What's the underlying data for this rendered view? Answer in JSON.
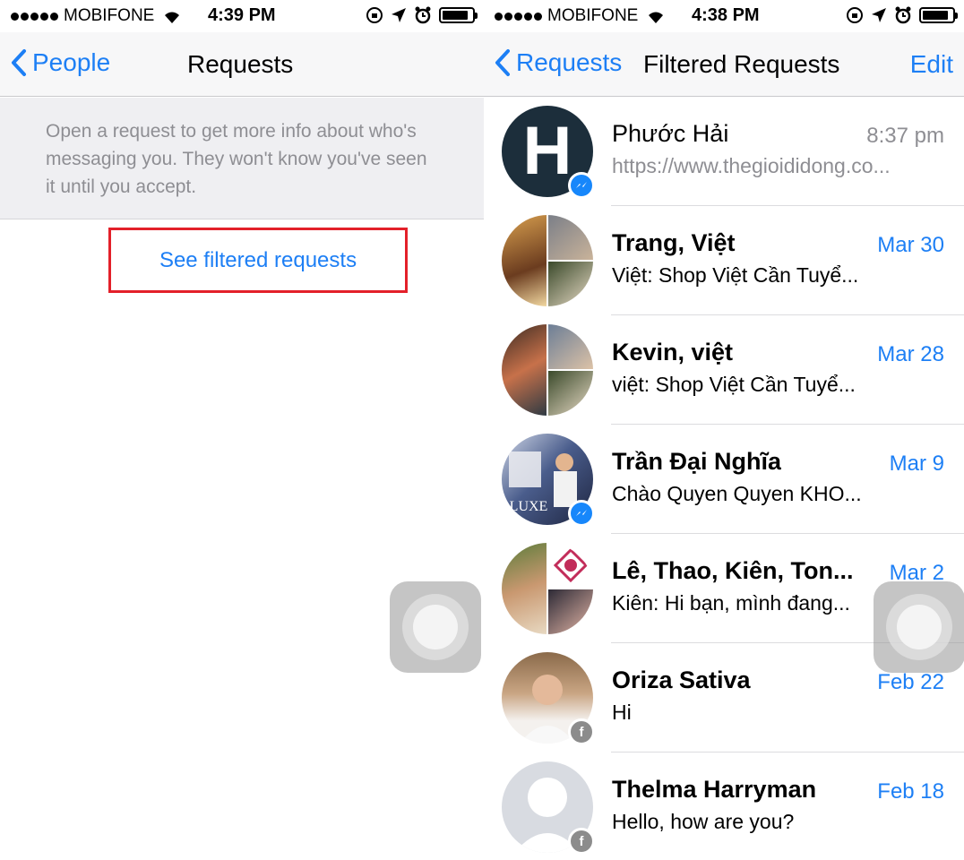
{
  "left": {
    "status": {
      "carrier": "MOBIFONE",
      "time": "4:39 PM"
    },
    "nav": {
      "back_label": "People",
      "title": "Requests"
    },
    "info_text": "Open a request to get more info about who's messaging you. They won't know you've seen it until you accept.",
    "filtered_link": "See filtered requests"
  },
  "right": {
    "status": {
      "carrier": "MOBIFONE",
      "time": "4:38 PM"
    },
    "nav": {
      "back_label": "Requests",
      "title": "Filtered Requests",
      "edit_label": "Edit"
    },
    "conversations": [
      {
        "name": "Phước Hải",
        "date": "8:37 pm",
        "preview": "https://www.thegioididong.co...",
        "badge": "messenger",
        "avatar": "letter-h"
      },
      {
        "name": "Trang, Việt",
        "date": "Mar 30",
        "preview": "Việt: Shop Việt Cần Tuyể...",
        "badge": "none",
        "avatar": "group"
      },
      {
        "name": "Kevin, việt",
        "date": "Mar 28",
        "preview": "việt: Shop Việt Cần Tuyể...",
        "badge": "none",
        "avatar": "group"
      },
      {
        "name": "Trần Đại Nghĩa",
        "date": "Mar 9",
        "preview": "Chào Quyen Quyen KHO...",
        "badge": "messenger",
        "avatar": "photo",
        "avatar_text": "LUXE"
      },
      {
        "name": "Lê, Thao, Kiên, Ton...",
        "date": "Mar 2",
        "preview": "Kiên: Hi bạn,  mình đang...",
        "badge": "none",
        "avatar": "group"
      },
      {
        "name": "Oriza Sativa",
        "date": "Feb 22",
        "preview": "Hi",
        "badge": "facebook",
        "avatar": "photo"
      },
      {
        "name": "Thelma Harryman",
        "date": "Feb 18",
        "preview": "Hello, how are you?",
        "badge": "facebook",
        "avatar": "silhouette"
      }
    ]
  },
  "colors": {
    "accent": "#1d7ff5",
    "highlight_box": "#e3202a",
    "messenger_badge": "#1787fb"
  }
}
